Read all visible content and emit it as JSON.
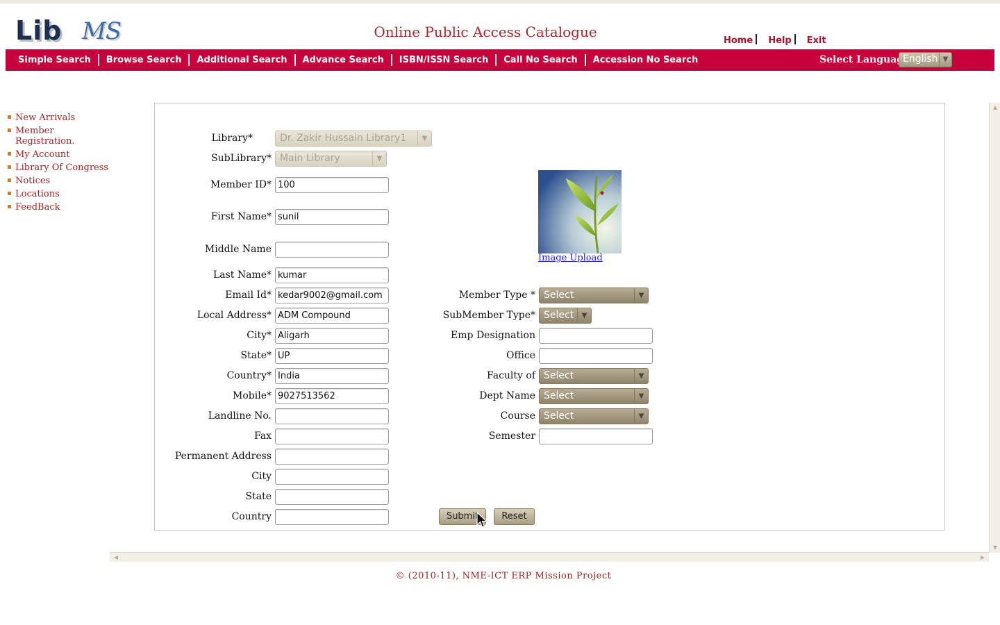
{
  "header": {
    "logo_lib": "Lib",
    "logo_ms": "MS",
    "title": "Online Public Access Catalogue",
    "links": [
      {
        "label": "Home"
      },
      {
        "label": "Help"
      },
      {
        "label": "Exit"
      }
    ]
  },
  "menu": {
    "items": [
      {
        "label": "Simple Search"
      },
      {
        "label": "Browse Search"
      },
      {
        "label": "Additional Search"
      },
      {
        "label": "Advance Search"
      },
      {
        "label": "ISBN/ISSN Search"
      },
      {
        "label": "Call No Search"
      },
      {
        "label": "Accession No Search"
      }
    ],
    "language_label": "Select Language",
    "language_value": "English"
  },
  "sidebar": {
    "items": [
      {
        "label": "New Arrivals"
      },
      {
        "label": "Member Registration."
      },
      {
        "label": "My Account"
      },
      {
        "label": "Library Of Congress"
      },
      {
        "label": "Notices"
      },
      {
        "label": "Locations"
      },
      {
        "label": "FeedBack"
      }
    ]
  },
  "form": {
    "library": {
      "label": "Library*",
      "value": "Dr. Zakir Hussain Library1"
    },
    "sublibrary": {
      "label": "SubLibrary*",
      "value": "Main Library"
    },
    "member_id": {
      "label": "Member ID*",
      "value": "100"
    },
    "first_name": {
      "label": "First Name*",
      "value": "sunil"
    },
    "middle_name": {
      "label": "Middle Name",
      "value": ""
    },
    "last_name": {
      "label": "Last Name*",
      "value": "kumar"
    },
    "email": {
      "label": "Email Id*",
      "value": "kedar9002@gmail.com"
    },
    "local_address": {
      "label": "Local Address*",
      "value": "ADM Compound"
    },
    "city": {
      "label": "City*",
      "value": "Aligarh"
    },
    "state": {
      "label": "State*",
      "value": "UP"
    },
    "country": {
      "label": "Country*",
      "value": "India"
    },
    "mobile": {
      "label": "Mobile*",
      "value": "9027513562"
    },
    "landline": {
      "label": "Landline No.",
      "value": ""
    },
    "fax": {
      "label": "Fax",
      "value": ""
    },
    "permanent_address": {
      "label": "Permanent Address",
      "value": ""
    },
    "perm_city": {
      "label": "City",
      "value": ""
    },
    "perm_state": {
      "label": "State",
      "value": ""
    },
    "perm_country": {
      "label": "Country",
      "value": ""
    },
    "member_type": {
      "label": "Member Type *",
      "value": "Select"
    },
    "submember_type": {
      "label": "SubMember Type*",
      "value": "Select"
    },
    "emp_designation": {
      "label": "Emp Designation",
      "value": ""
    },
    "office": {
      "label": "Office",
      "value": ""
    },
    "faculty": {
      "label": "Faculty of",
      "value": "Select"
    },
    "dept": {
      "label": "Dept Name",
      "value": "Select"
    },
    "course": {
      "label": "Course",
      "value": "Select"
    },
    "semester": {
      "label": "Semester",
      "value": ""
    },
    "image_upload": "Image Upload",
    "submit": "Submit",
    "reset": "Reset"
  },
  "footer": {
    "text": "© (2010-11), NME-ICT ERP Mission Project"
  },
  "colors": {
    "menubar": "#c8003c",
    "link_red": "#9b2424",
    "title_red": "#b0262a"
  }
}
